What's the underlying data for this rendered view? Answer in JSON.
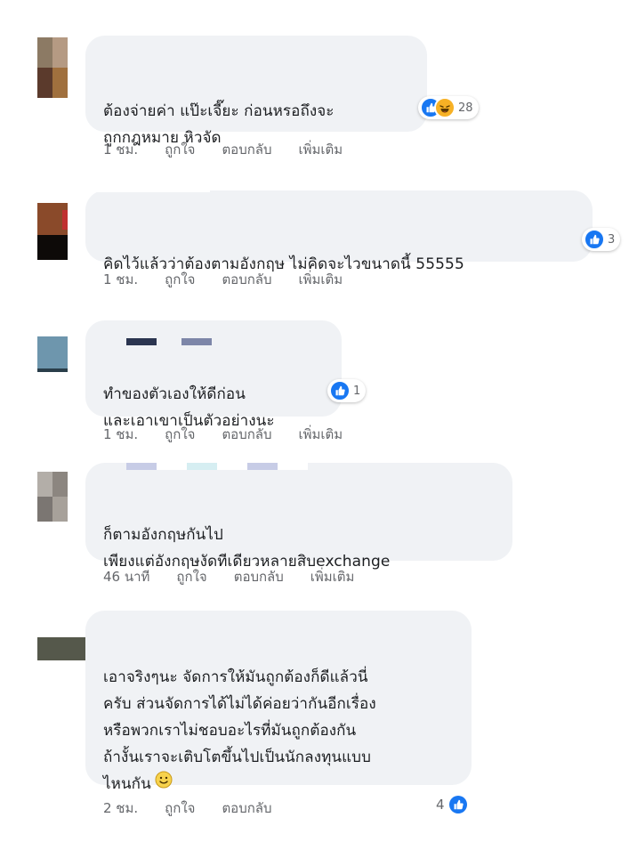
{
  "colors": {
    "bubble_bg": "#f0f2f5",
    "meta_text": "#65676b",
    "like_blue": "#1877f2",
    "haha_yellow": "#f7b125"
  },
  "comments": [
    {
      "text_lines": [
        "ต้องจ่ายค่า แป๊ะเจี๊ยะ ก่อนหรอถึงจะ",
        "ถูกกฎหมาย หิวจัด"
      ],
      "reactions": {
        "icons": [
          "like-icon",
          "haha-icon"
        ],
        "count": "28"
      },
      "time": "1 ชม.",
      "like_label": "ถูกใจ",
      "reply_label": "ตอบกลับ",
      "more_label": "เพิ่มเติม"
    },
    {
      "text_lines": [
        "คิดไว้แล้วว่าต้องตามอังกฤษ ไม่คิดจะไวขนาดนี้ 55555"
      ],
      "reactions": {
        "icons": [
          "like-icon"
        ],
        "count": "3"
      },
      "time": "1 ชม.",
      "like_label": "ถูกใจ",
      "reply_label": "ตอบกลับ",
      "more_label": "เพิ่มเติม"
    },
    {
      "text_lines": [
        "ทำของตัวเองให้ดีก่อน",
        "และเอาเขาเป็นตัวอย่างนะ"
      ],
      "reactions": {
        "icons": [
          "like-icon"
        ],
        "count": "1"
      },
      "time": "1 ชม.",
      "like_label": "ถูกใจ",
      "reply_label": "ตอบกลับ",
      "more_label": "เพิ่มเติม"
    },
    {
      "text_lines": [
        "ก็ตามอังกฤษกันไป",
        "เพียงแต่อังกฤษงัดทีเดียวหลายสิบexchange"
      ],
      "time": "46 นาที",
      "like_label": "ถูกใจ",
      "reply_label": "ตอบกลับ",
      "more_label": "เพิ่มเติม"
    },
    {
      "text_lines": [
        "เอาจริงๆนะ จัดการให้มันถูกต้องก็ดีแล้วนี่",
        "ครับ ส่วนจัดการได้ไม่ได้ค่อยว่ากันอีกเรื่อง",
        "หรือพวกเราไม่ชอบอะไรที่มันถูกต้องกัน",
        "ถ้างั้นเราจะเติบโตขึ้นไปเป็นนักลงทุนแบบ",
        "ไหนกัน"
      ],
      "emoji": "smile-emoji",
      "time": "2 ชม.",
      "like_label": "ถูกใจ",
      "reply_label": "ตอบกลับ",
      "like_count": "4"
    }
  ]
}
